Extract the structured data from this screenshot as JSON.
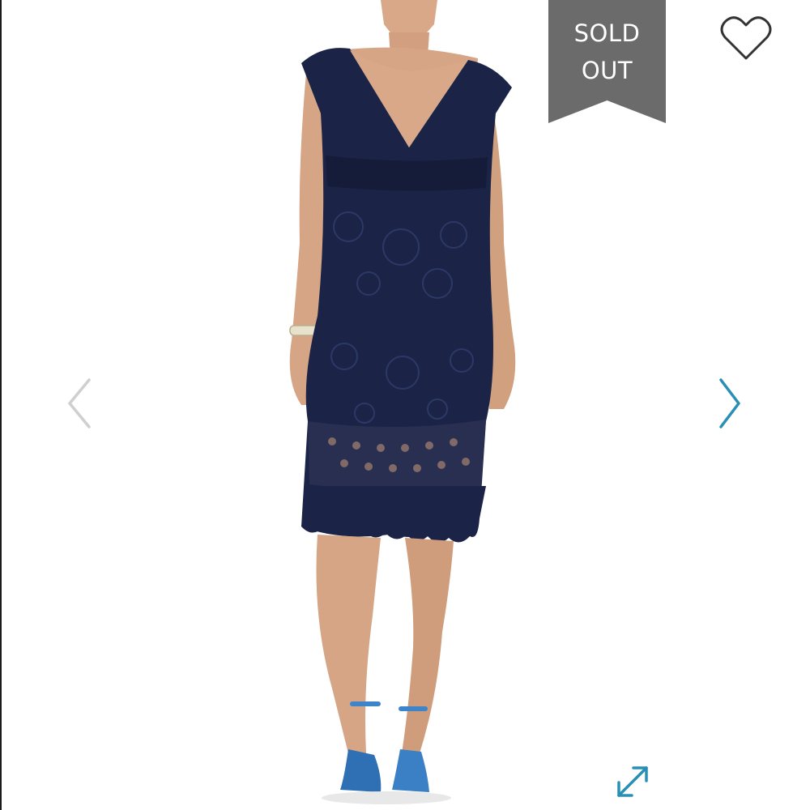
{
  "badge": {
    "line1": "SOLD",
    "line2": "OUT",
    "color": "#6b6b6b"
  },
  "icons": {
    "prev": "chevron-left-icon",
    "next": "chevron-right-icon",
    "like": "heart-outline-icon",
    "expand": "expand-arrows-icon"
  },
  "colors": {
    "accent": "#2a8fb5",
    "dress": "#1b2447",
    "prev_arrow": "#cfcfcf",
    "heart": "#333333"
  }
}
